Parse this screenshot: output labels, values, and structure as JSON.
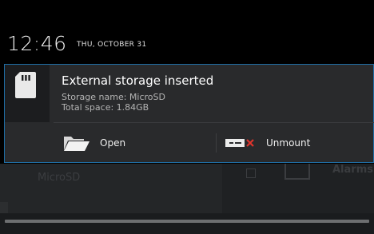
{
  "status_bar": {
    "time": "12:46",
    "date": "THU, OCTOBER 31"
  },
  "background_app": {
    "left_label": "MicroSD",
    "right_label": "Alarms"
  },
  "notification": {
    "icon": "sd-card-icon",
    "title": "External storage inserted",
    "lines": [
      "Storage name: MicroSD",
      "Total space: 1.84GB"
    ],
    "actions": [
      {
        "label": "Open",
        "icon": "folder-icon"
      },
      {
        "label": "Unmount",
        "icon": "unmount-icon"
      }
    ]
  },
  "colors": {
    "accent": "#1f6ea5",
    "panel": "#292a2c",
    "unmount_x": "#e0342c"
  }
}
